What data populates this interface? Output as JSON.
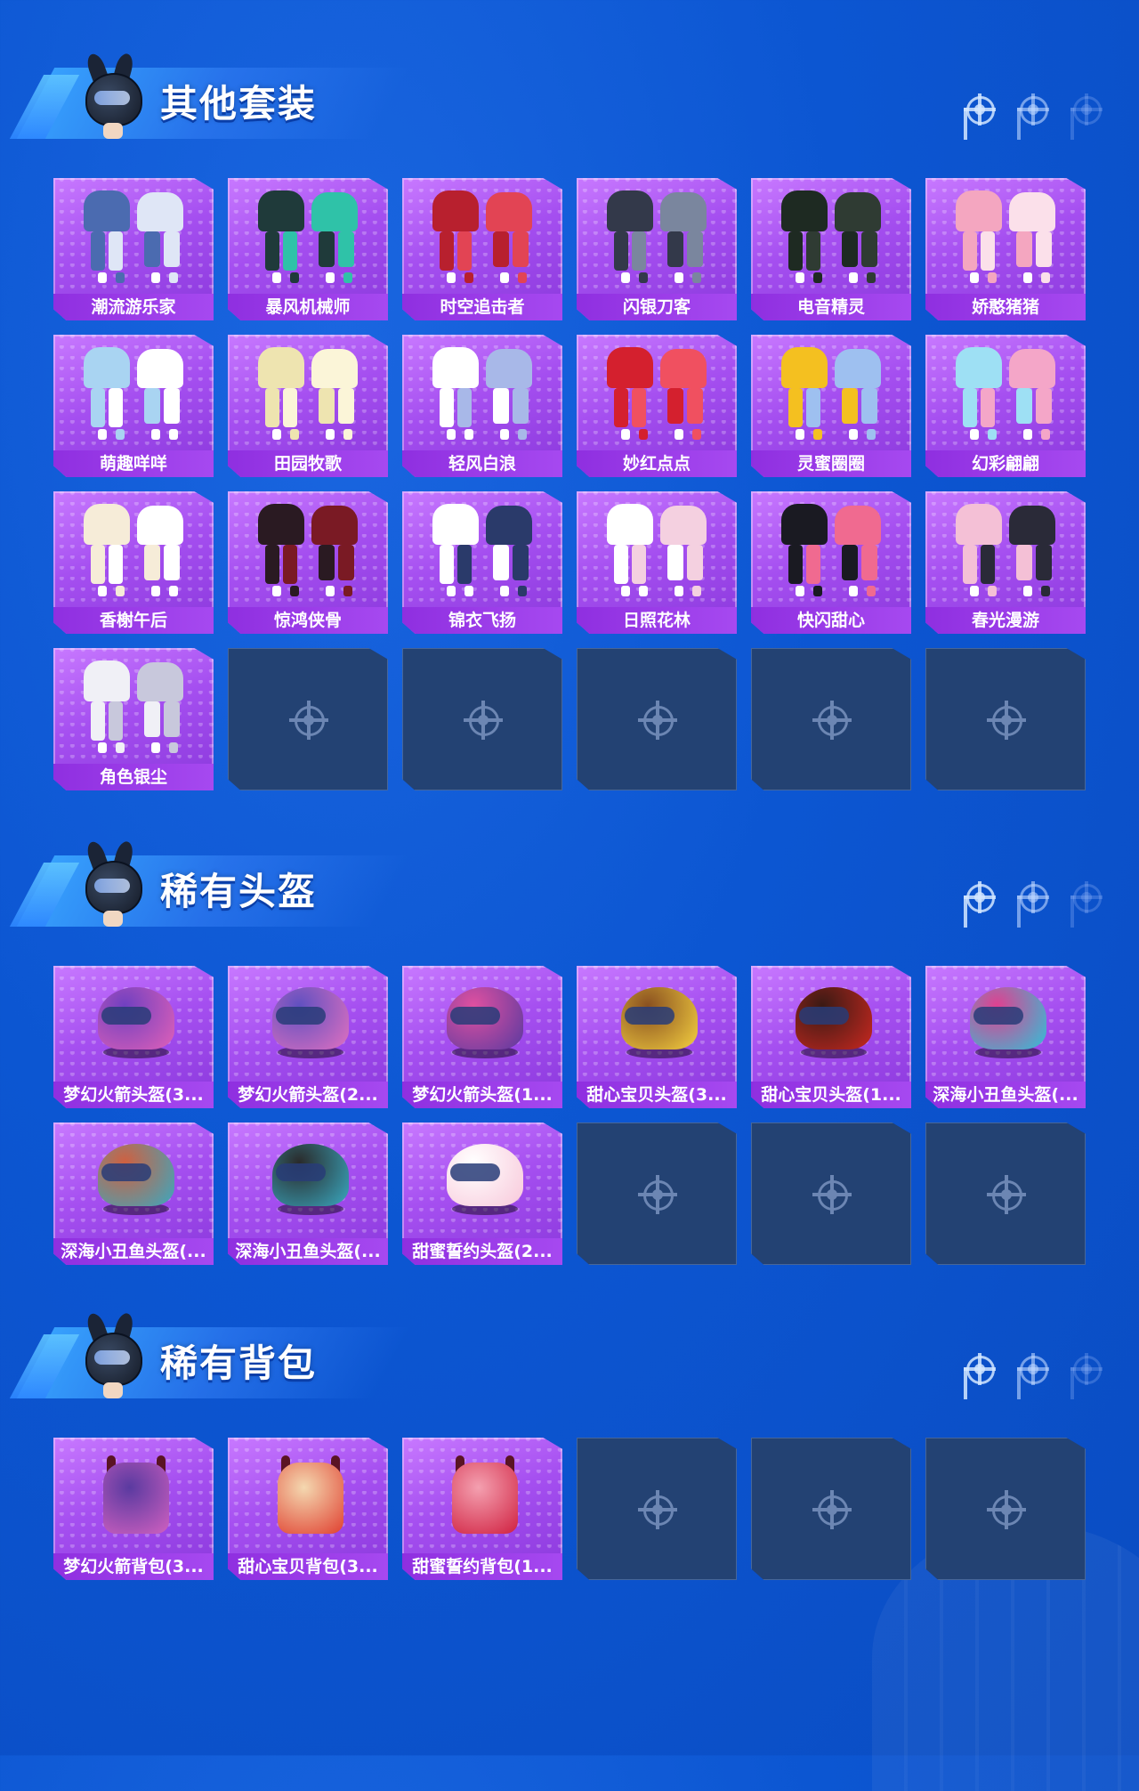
{
  "sections": [
    {
      "title": "其他套装",
      "items": [
        {
          "label": "潮流游乐家",
          "colors": [
            "#4b6bb0",
            "#dfe6f6"
          ]
        },
        {
          "label": "暴风机械师",
          "colors": [
            "#1f3a3a",
            "#2fc2a8"
          ]
        },
        {
          "label": "时空追击者",
          "colors": [
            "#b8202e",
            "#e24454"
          ]
        },
        {
          "label": "闪银刀客",
          "colors": [
            "#33394a",
            "#7a869e"
          ]
        },
        {
          "label": "电音精灵",
          "colors": [
            "#1e2a22",
            "#2f3b33"
          ]
        },
        {
          "label": "娇憨猪猪",
          "colors": [
            "#f4a6c0",
            "#fbe0ea"
          ]
        },
        {
          "label": "萌趣咩咩",
          "colors": [
            "#a9d4f2",
            "#ffffff"
          ]
        },
        {
          "label": "田园牧歌",
          "colors": [
            "#eee4b0",
            "#fbf5d8"
          ]
        },
        {
          "label": "轻风白浪",
          "colors": [
            "#ffffff",
            "#a8b8e8"
          ]
        },
        {
          "label": "妙红点点",
          "colors": [
            "#d4202e",
            "#f05060"
          ]
        },
        {
          "label": "灵蜜圈圈",
          "colors": [
            "#f4c020",
            "#9ec0f0"
          ]
        },
        {
          "label": "幻彩翩翩",
          "colors": [
            "#9ee0f4",
            "#f4a6c8"
          ]
        },
        {
          "label": "香榭午后",
          "colors": [
            "#f6ecd8",
            "#ffffff"
          ]
        },
        {
          "label": "惊鸿侠骨",
          "colors": [
            "#2a1a22",
            "#7a1a24"
          ]
        },
        {
          "label": "锦衣飞扬",
          "colors": [
            "#ffffff",
            "#2a3a6a"
          ]
        },
        {
          "label": "日照花林",
          "colors": [
            "#ffffff",
            "#f4d0e0"
          ]
        },
        {
          "label": "快闪甜心",
          "colors": [
            "#1a1a22",
            "#f06a90"
          ]
        },
        {
          "label": "春光漫游",
          "colors": [
            "#f4c0d6",
            "#2a2a38"
          ]
        },
        {
          "label": "角色银尘",
          "colors": [
            "#f0f0f6",
            "#c8c8dc"
          ]
        }
      ],
      "empty_slots": 5
    },
    {
      "title": "稀有头盔",
      "items": [
        {
          "label": "梦幻火箭头盔(3...",
          "colors": [
            "#e060b8",
            "#7040c0"
          ]
        },
        {
          "label": "梦幻火箭头盔(2...",
          "colors": [
            "#e070c0",
            "#6050c0"
          ]
        },
        {
          "label": "梦幻火箭头盔(1...",
          "colors": [
            "#5a3aa0",
            "#e050a0"
          ]
        },
        {
          "label": "甜心宝贝头盔(3...",
          "colors": [
            "#f4d040",
            "#8a5020"
          ]
        },
        {
          "label": "甜心宝贝头盔(1...",
          "colors": [
            "#c82820",
            "#3a1a14"
          ]
        },
        {
          "label": "深海小丑鱼头盔(...",
          "colors": [
            "#30c0d8",
            "#e04090"
          ]
        },
        {
          "label": "深海小丑鱼头盔(...",
          "colors": [
            "#3aa8c0",
            "#d06040"
          ]
        },
        {
          "label": "深海小丑鱼头盔(...",
          "colors": [
            "#3aa8c0",
            "#2a2a2a"
          ]
        },
        {
          "label": "甜蜜誓约头盔(2...",
          "colors": [
            "#f8c8da",
            "#ffffff"
          ]
        }
      ],
      "empty_slots": 3
    },
    {
      "title": "稀有背包",
      "items": [
        {
          "label": "梦幻火箭背包(3...",
          "colors": [
            "#d060c0",
            "#5a3aa0"
          ]
        },
        {
          "label": "甜心宝贝背包(3...",
          "colors": [
            "#e04030",
            "#f4d8b0"
          ]
        },
        {
          "label": "甜蜜誓约背包(1...",
          "colors": [
            "#d02040",
            "#f4a0b0"
          ]
        }
      ],
      "empty_slots": 3
    }
  ],
  "nav_dots": [
    "crosshair-icon",
    "crosshair-icon",
    "crosshair-icon"
  ],
  "theme": {
    "accent": "#a54ff0",
    "bg": "#0c56d2",
    "empty_card": "#234273"
  }
}
